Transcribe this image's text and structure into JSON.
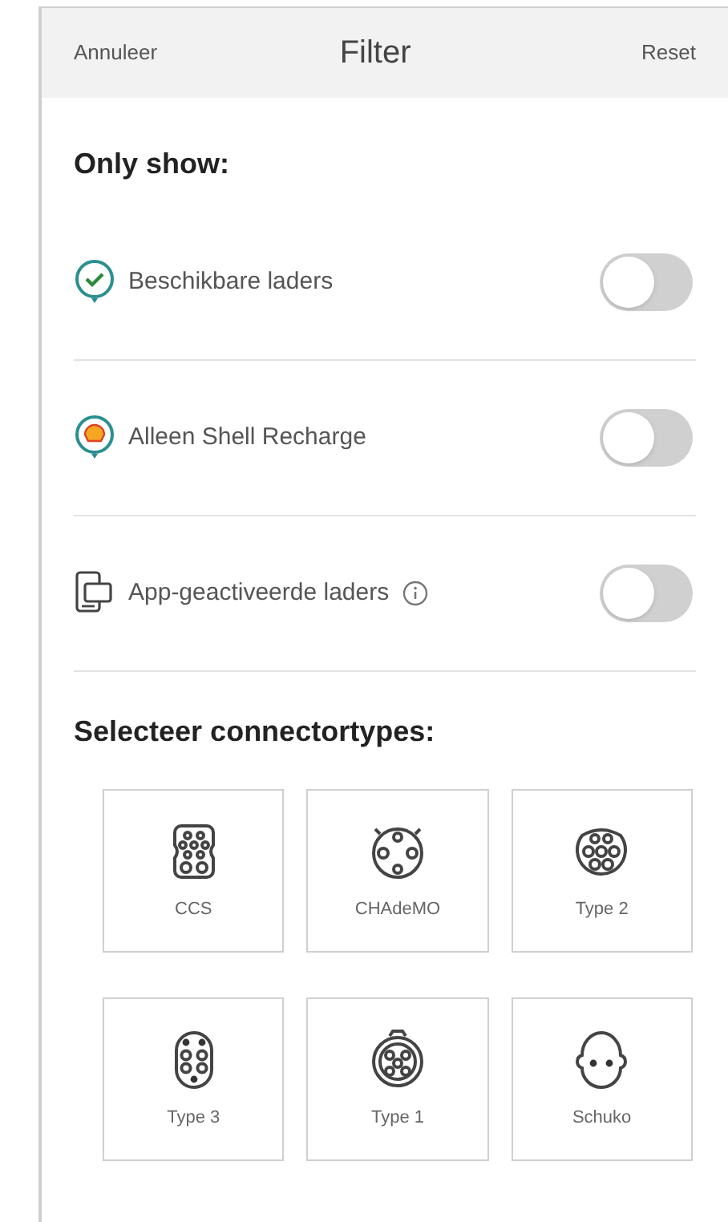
{
  "header": {
    "cancel": "Annuleer",
    "title": "Filter",
    "reset": "Reset"
  },
  "only_show": {
    "heading": "Only show:",
    "options": [
      {
        "kind": "available",
        "label": "Beschikbare laders",
        "on": false,
        "info": false
      },
      {
        "kind": "shell",
        "label": "Alleen Shell Recharge",
        "on": false,
        "info": false
      },
      {
        "kind": "app",
        "label": "App-geactiveerde laders",
        "on": false,
        "info": true
      }
    ]
  },
  "connectors": {
    "heading": "Selecteer connectortypes:",
    "items": [
      {
        "kind": "ccs",
        "label": "CCS"
      },
      {
        "kind": "chademo",
        "label": "CHAdeMO"
      },
      {
        "kind": "type2",
        "label": "Type 2"
      },
      {
        "kind": "type3",
        "label": "Type 3"
      },
      {
        "kind": "type1",
        "label": "Type 1"
      },
      {
        "kind": "schuko",
        "label": "Schuko"
      }
    ]
  }
}
